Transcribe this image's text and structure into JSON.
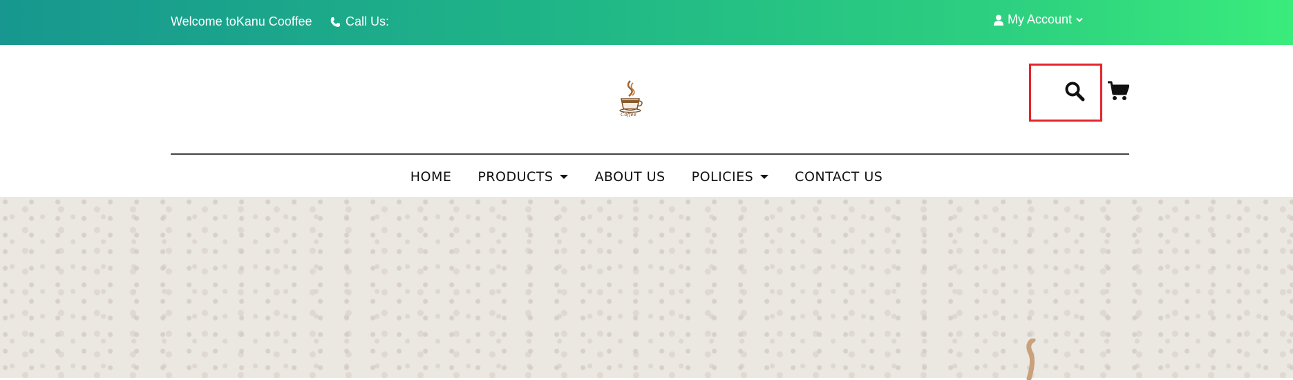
{
  "topbar": {
    "welcome": "Welcome toKanu Cooffee",
    "call_label": "Call Us:",
    "account_label": "My Account"
  },
  "header": {
    "logo_text": "Coffee",
    "search_icon": "search-icon",
    "cart_icon": "cart-icon"
  },
  "nav": {
    "items": [
      {
        "label": "HOME",
        "dropdown": false
      },
      {
        "label": "PRODUCTS",
        "dropdown": true
      },
      {
        "label": "ABOUT US",
        "dropdown": false
      },
      {
        "label": "POLICIES",
        "dropdown": true
      },
      {
        "label": "CONTACT US",
        "dropdown": false
      }
    ]
  },
  "colors": {
    "gradient_start": "#17978f",
    "gradient_end": "#3aec7c",
    "highlight_border": "#e3242b",
    "hero_bg": "#ebe7e1"
  }
}
